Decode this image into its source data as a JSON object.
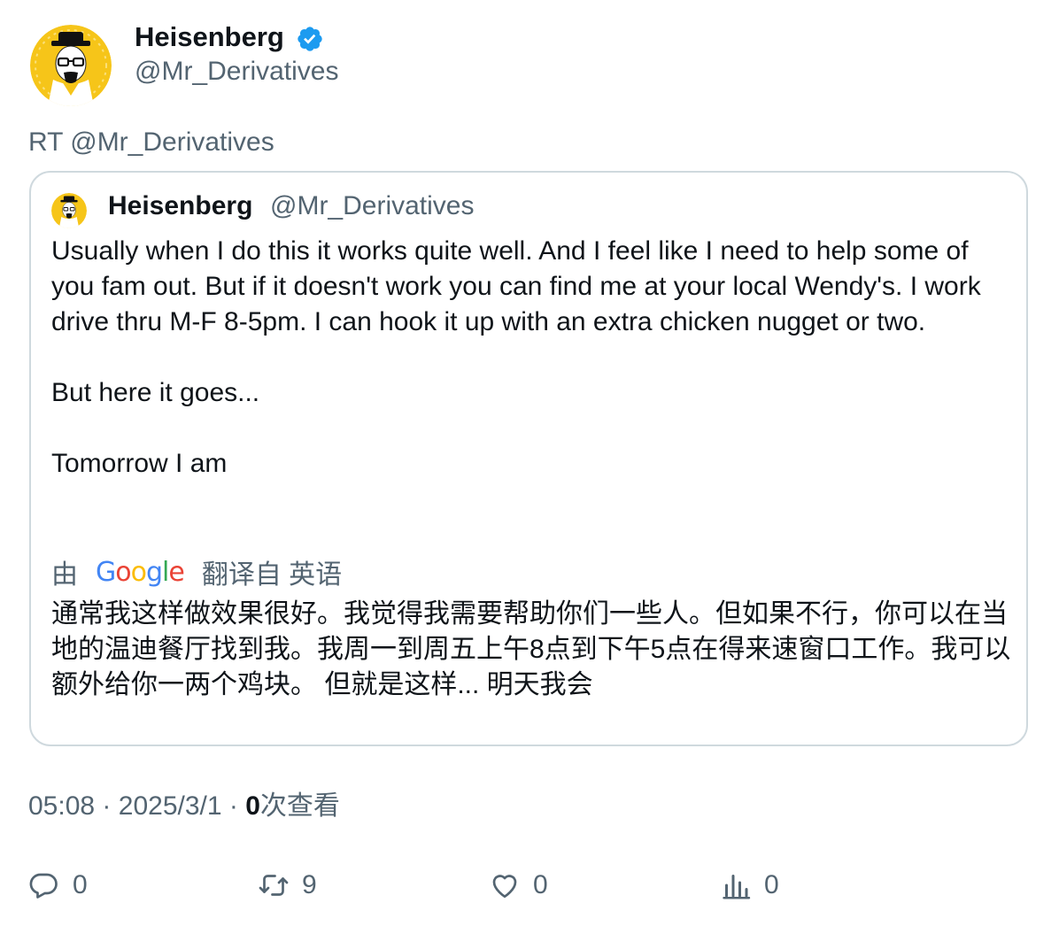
{
  "author": {
    "display_name": "Heisenberg",
    "handle": "@Mr_Derivatives",
    "verified_icon": "verified-badge-icon",
    "brand_color": "#1d9bf0"
  },
  "retweet_text": "RT @Mr_Derivatives",
  "quoted": {
    "display_name": "Heisenberg",
    "handle": "@Mr_Derivatives",
    "paragraphs": [
      "Usually when I do this it works quite well. And I feel like I need to help some of you fam out. But if it doesn't work you can find me at your local Wendy's. I work drive thru M-F 8-5pm. I can hook it up with an extra chicken nugget or two.",
      "But here it goes...",
      "Tomorrow I am"
    ],
    "translation": {
      "prefix": "由",
      "provider": "Google",
      "suffix": "翻译自 英语",
      "text": "通常我这样做效果很好。我觉得我需要帮助你们一些人。但如果不行，你可以在当地的温迪餐厅找到我。我周一到周五上午8点到下午5点在得来速窗口工作。我可以额外给你一两个鸡块。 但就是这样... 明天我会"
    }
  },
  "meta": {
    "time": "05:08",
    "separator": "·",
    "date": "2025/3/1",
    "views_count": "0",
    "views_label": "次查看"
  },
  "actions": {
    "reply": {
      "icon": "reply-icon",
      "count": "0"
    },
    "retweet": {
      "icon": "retweet-icon",
      "count": "9"
    },
    "like": {
      "icon": "heart-icon",
      "count": "0"
    },
    "views": {
      "icon": "analytics-icon",
      "count": "0"
    }
  },
  "colors": {
    "text_primary": "#0f1419",
    "text_secondary": "#536471",
    "border": "#cfd9de",
    "avatar_yellow": "#f6c519"
  }
}
